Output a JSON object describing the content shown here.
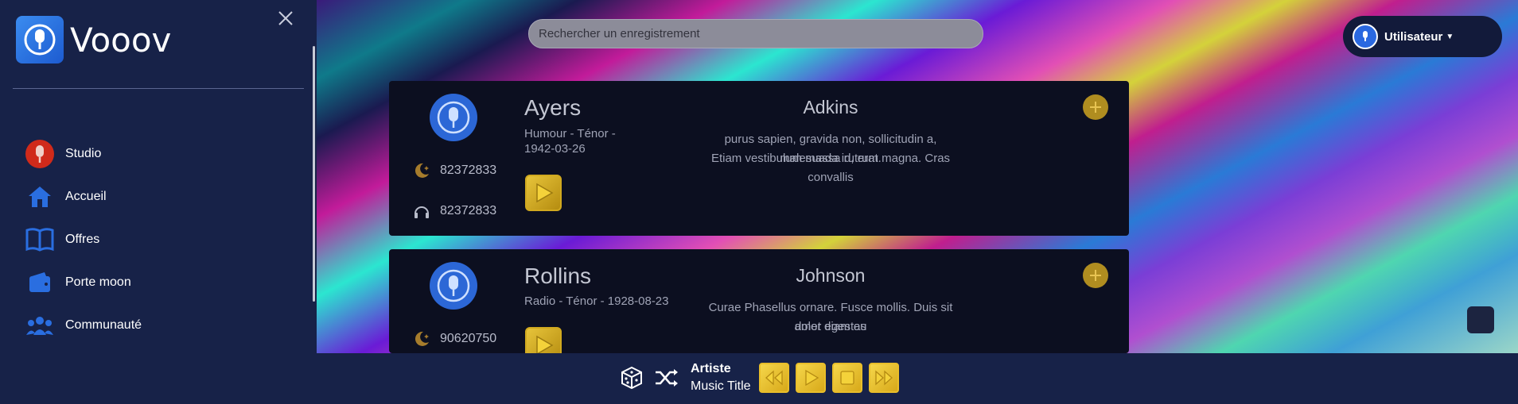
{
  "app": {
    "name": "Vooov"
  },
  "sidebar": {
    "items": [
      {
        "label": "Studio",
        "icon": "microphone-icon"
      },
      {
        "label": "Accueil",
        "icon": "home-icon"
      },
      {
        "label": "Offres",
        "icon": "book-icon"
      },
      {
        "label": "Porte moon",
        "icon": "wallet-icon"
      },
      {
        "label": "Communauté",
        "icon": "community-icon"
      }
    ]
  },
  "search": {
    "placeholder": "Rechercher un enregistrement",
    "value": ""
  },
  "user": {
    "label": "Utilisateur"
  },
  "cards": [
    {
      "name": "Ayers",
      "meta_line1": "Humour - Ténor -",
      "meta_line2": "1942-03-26",
      "stat_moon": "82372833",
      "stat_listen": "82372833",
      "title": "Adkins",
      "desc_line1": "purus sapien, gravida non, sollicitudin a, malesuada id, erat.",
      "desc_line2": "Etiam vestibulum massa rutrum magna. Cras convallis"
    },
    {
      "name": "Rollins",
      "meta_line1": "Radio - Ténor - 1928-08-23",
      "stat_moon": "90620750",
      "title": "Johnson",
      "desc_line1": "Curae Phasellus ornare. Fusce mollis. Duis sit amet diam eu",
      "desc_line2": "dolor egestas"
    }
  ],
  "player": {
    "artist": "Artiste",
    "title": "Music Title"
  },
  "colors": {
    "accent_gold": "#e0b62c",
    "sidebar_bg": "#172248",
    "card_bg": "#0c0f20"
  }
}
